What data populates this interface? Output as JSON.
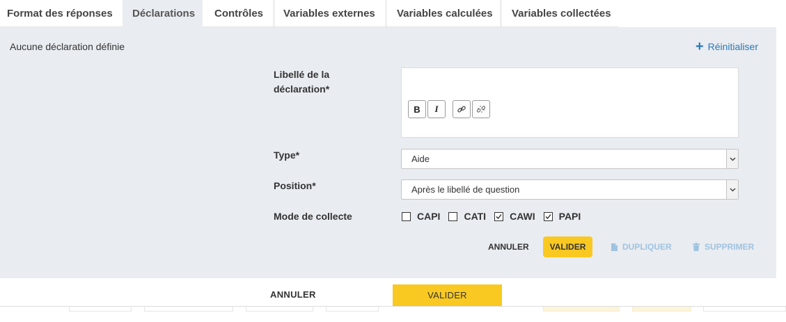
{
  "tabs": [
    {
      "label": "Format des réponses",
      "active": false
    },
    {
      "label": "Déclarations",
      "active": true
    },
    {
      "label": "Contrôles",
      "active": false
    },
    {
      "label": "Variables externes",
      "active": false
    },
    {
      "label": "Variables calculées",
      "active": false
    },
    {
      "label": "Variables collectées",
      "active": false
    }
  ],
  "panel": {
    "empty_message": "Aucune déclaration définie",
    "reset_label": "Réinitialiser",
    "form": {
      "libelle_label": "Libellé de la déclaration*",
      "libelle_value": "",
      "editor_buttons": [
        {
          "name": "bold",
          "glyph": "B"
        },
        {
          "name": "italic",
          "glyph": "I"
        },
        {
          "name": "link",
          "icon": "link-icon"
        },
        {
          "name": "unlink",
          "icon": "unlink-icon"
        }
      ],
      "type_label": "Type*",
      "type_value": "Aide",
      "position_label": "Position*",
      "position_value": "Après le libellé de question",
      "mode_label": "Mode de collecte",
      "modes": [
        {
          "label": "CAPI",
          "checked": false
        },
        {
          "label": "CATI",
          "checked": false
        },
        {
          "label": "CAWI",
          "checked": true
        },
        {
          "label": "PAPI",
          "checked": true
        }
      ]
    },
    "actions": {
      "cancel": "ANNULER",
      "validate": "VALIDER",
      "duplicate": "DUPLIQUER",
      "delete": "SUPPRIMER"
    }
  },
  "footer": {
    "cancel": "ANNULER",
    "validate": "VALIDER"
  },
  "colors": {
    "accent_yellow": "#f9c921",
    "link_blue": "#2a79b6",
    "disabled_blue": "#9fc3e0",
    "panel_bg": "#e9ecf1"
  }
}
